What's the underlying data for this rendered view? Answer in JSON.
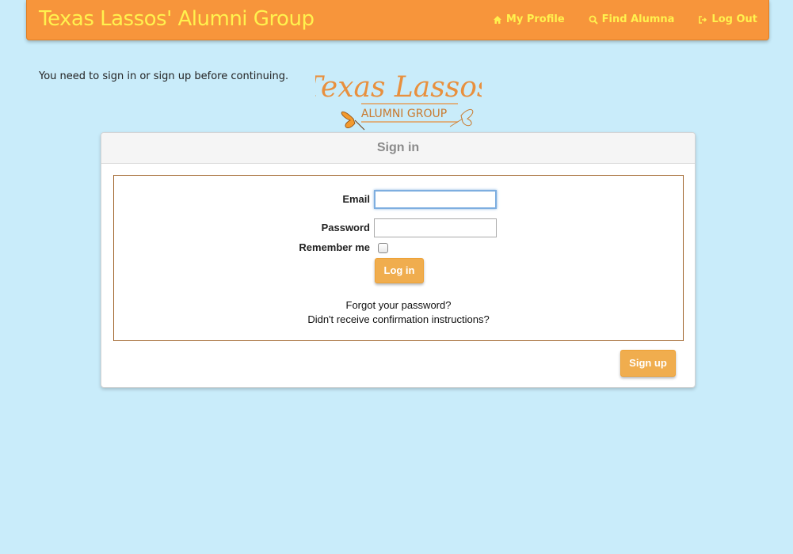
{
  "navbar": {
    "brand": "Texas Lassos' Alumni Group",
    "links": [
      {
        "label": "My Profile",
        "icon": "home-icon"
      },
      {
        "label": "Find Alumna",
        "icon": "search-icon"
      },
      {
        "label": "Log Out",
        "icon": "logout-icon"
      }
    ]
  },
  "notice": "You need to sign in or sign up before continuing.",
  "logo": {
    "line1": "Texas Lassos",
    "line2": "ALUMNI GROUP"
  },
  "signin": {
    "heading": "Sign in",
    "email_label": "Email",
    "email_value": "",
    "password_label": "Password",
    "password_value": "",
    "remember_label": "Remember me",
    "remember_checked": false,
    "login_button": "Log in",
    "forgot_link": "Forgot your password?",
    "confirm_link": "Didn't receive confirmation instructions?",
    "signup_button": "Sign up"
  },
  "colors": {
    "navbar": "#f7953b",
    "brand_text": "#fff14e",
    "background": "#c9ecfa",
    "button": "#f0ad4e",
    "box_border": "#a0642b"
  }
}
